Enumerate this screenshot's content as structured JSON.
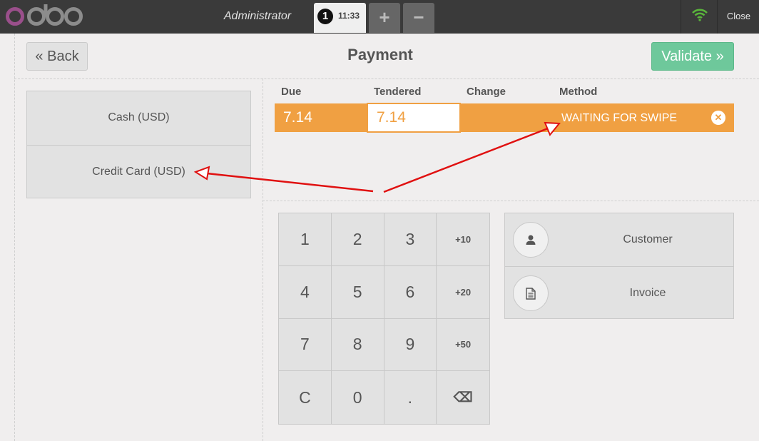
{
  "header": {
    "logo_text": "odoo",
    "username": "Administrator",
    "order": {
      "number": "1",
      "time": "11:33"
    },
    "add_order_label": "+",
    "remove_order_label": "−",
    "close_label": "Close"
  },
  "toolbar": {
    "back_label": "« Back",
    "title": "Payment",
    "validate_label": "Validate »"
  },
  "payment_methods": [
    {
      "label": "Cash (USD)"
    },
    {
      "label": "Credit Card (USD)"
    }
  ],
  "paymentlines": {
    "headers": {
      "due": "Due",
      "tendered": "Tendered",
      "change": "Change",
      "method": "Method"
    },
    "line": {
      "due": "7.14",
      "tendered": "7.14",
      "change": "",
      "method": "WAITING FOR SWIPE",
      "remove": "✕"
    }
  },
  "numpad": {
    "keys": [
      [
        "1",
        "2",
        "3",
        "+10"
      ],
      [
        "4",
        "5",
        "6",
        "+20"
      ],
      [
        "7",
        "8",
        "9",
        "+50"
      ],
      [
        "C",
        "0",
        ".",
        "⌫"
      ]
    ]
  },
  "client": {
    "customer_label": "Customer",
    "invoice_label": "Invoice"
  },
  "colors": {
    "topbar": "#3a3a3a",
    "accent_orange": "#f0a042",
    "validate_green": "#6ec89b",
    "logo_purple": "#9a4f8b",
    "wifi_green": "#5ab63b",
    "annotation_red": "#e01010"
  }
}
